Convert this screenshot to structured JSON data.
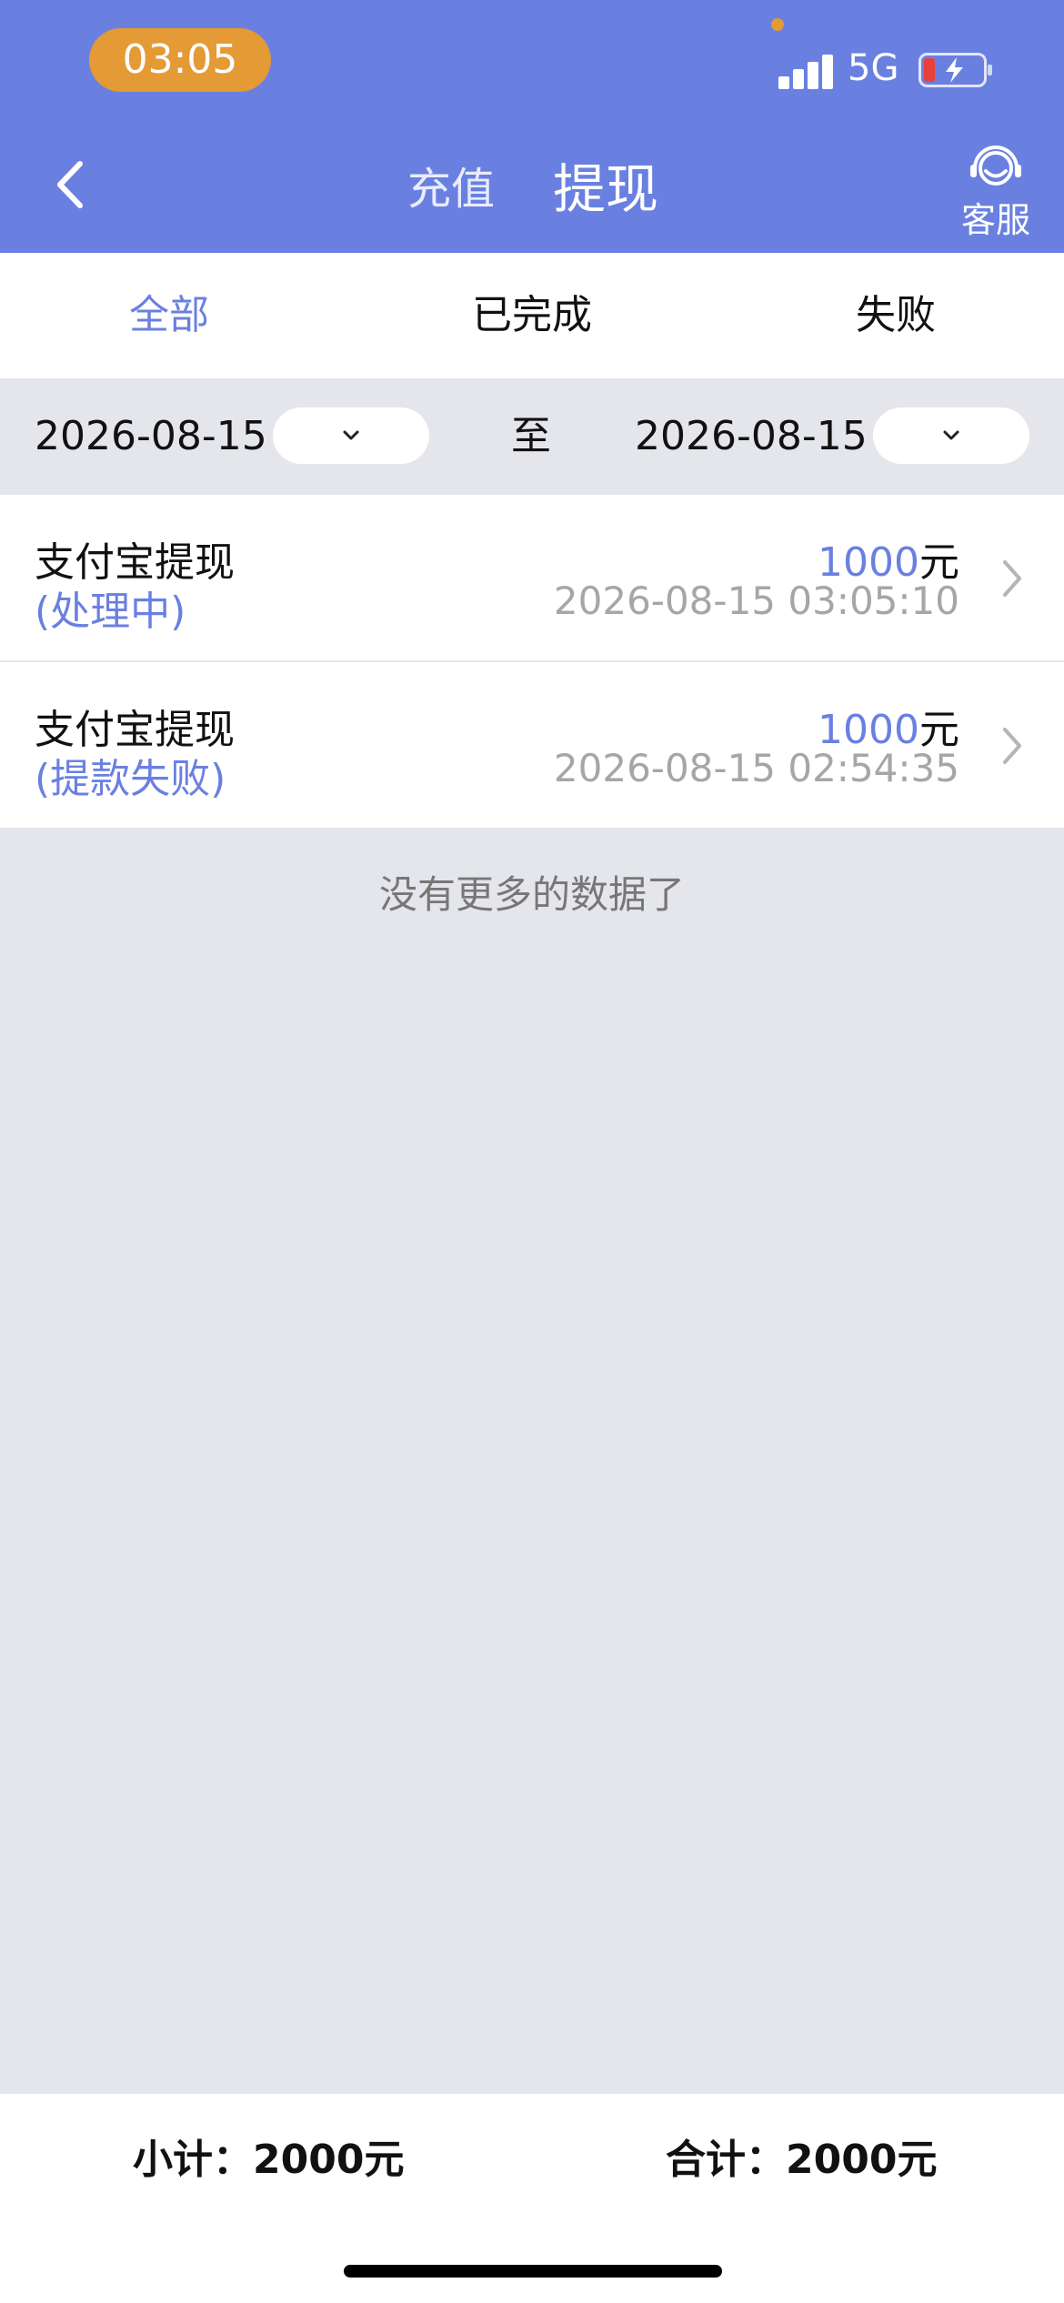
{
  "status_bar": {
    "time": "03:05",
    "network": "5G"
  },
  "header": {
    "tabs": [
      {
        "label": "充值",
        "active": false
      },
      {
        "label": "提现",
        "active": true
      }
    ],
    "service_label": "客服"
  },
  "filter_tabs": [
    {
      "label": "全部",
      "active": true
    },
    {
      "label": "已完成",
      "active": false
    },
    {
      "label": "失败",
      "active": false
    }
  ],
  "date_range": {
    "start": "2026-08-15",
    "separator": "至",
    "end": "2026-08-15"
  },
  "records": [
    {
      "title": "支付宝提现",
      "status": "(处理中)",
      "amount": "1000",
      "unit": "元",
      "time": "2026-08-15 03:05:10"
    },
    {
      "title": "支付宝提现",
      "status": "(提款失败)",
      "amount": "1000",
      "unit": "元",
      "time": "2026-08-15 02:54:35"
    }
  ],
  "no_more_text": "没有更多的数据了",
  "footer": {
    "subtotal": "小计：2000元",
    "total": "合计：2000元"
  },
  "colors": {
    "accent": "#6a80e0",
    "status_time_bg": "#e49a35",
    "page_bg": "#e5e6eb"
  }
}
